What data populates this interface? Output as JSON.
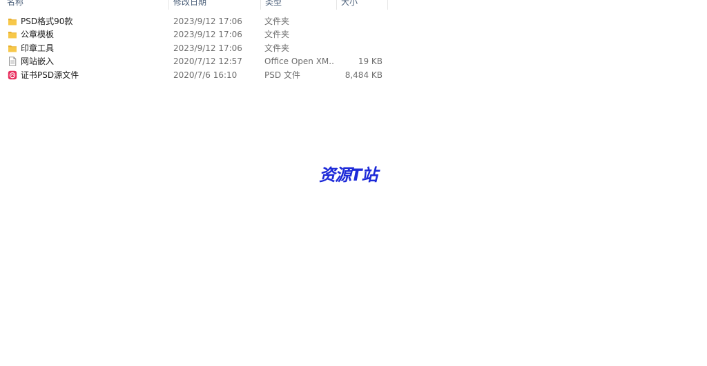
{
  "columns": {
    "name": "名称",
    "date": "修改日期",
    "type": "类型",
    "size": "大小"
  },
  "files": [
    {
      "name": "PSD格式90款",
      "date": "2023/9/12 17:06",
      "type": "文件夹",
      "size": "",
      "icon": "folder-icon"
    },
    {
      "name": "公章模板",
      "date": "2023/9/12 17:06",
      "type": "文件夹",
      "size": "",
      "icon": "folder-icon"
    },
    {
      "name": "印章工具",
      "date": "2023/9/12 17:06",
      "type": "文件夹",
      "size": "",
      "icon": "folder-icon"
    },
    {
      "name": "网站嵌入",
      "date": "2020/7/12 12:57",
      "type": "Office Open XM...",
      "size": "19 KB",
      "icon": "document-icon"
    },
    {
      "name": "证书PSD源文件",
      "date": "2020/7/6 16:10",
      "type": "PSD 文件",
      "size": "8,484 KB",
      "icon": "psd-file-icon"
    }
  ],
  "watermark": "资源T站",
  "colors": {
    "folder": "#f7c84a",
    "folder_dark": "#e8b02e",
    "psd_icon": "#e8305f",
    "watermark": "#1d2ad8"
  }
}
